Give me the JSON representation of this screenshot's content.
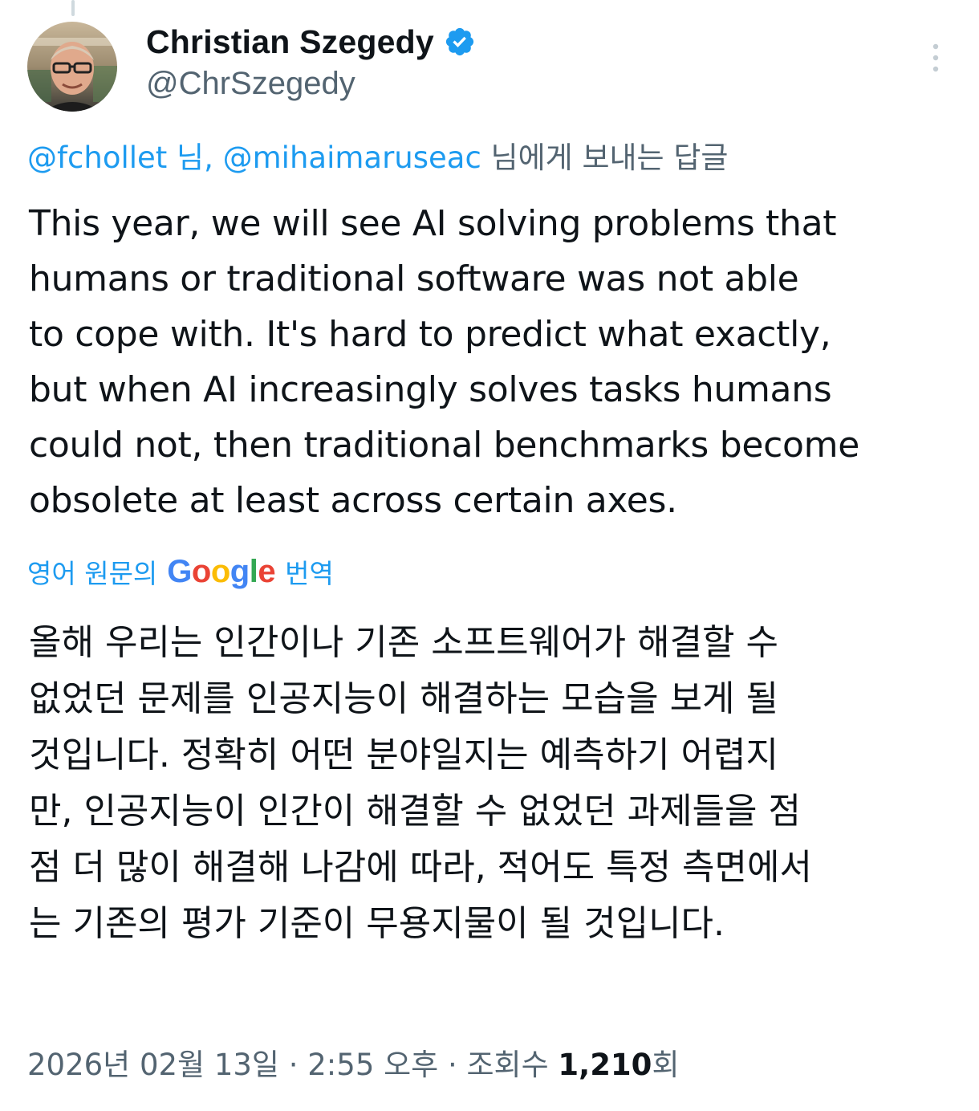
{
  "author": {
    "display_name": "Christian Szegedy",
    "handle": "@ChrSzegedy",
    "verified_icon": "verified-badge-icon",
    "verified_color": "#1d9bf0"
  },
  "reply_to": {
    "mention_1": "@fchollet",
    "separator_1": " 님, ",
    "mention_2": "@mihaimaruseac",
    "suffix": " 님에게 보내는 답글"
  },
  "tweet": {
    "lines": [
      "This year, we will see AI solving problems that",
      "humans or traditional software was not able",
      "to cope with. It's hard to predict what exactly,",
      "but when AI increasingly solves tasks humans",
      "could not, then traditional benchmarks become",
      "obsolete at least across certain axes."
    ]
  },
  "translation": {
    "prefix": "영어 원문의",
    "google_letters": [
      "G",
      "o",
      "o",
      "g",
      "l",
      "e"
    ],
    "suffix": "번역",
    "lines": [
      "올해 우리는 인간이나 기존 소프트웨어가 해결할 수",
      "없었던 문제를 인공지능이 해결하는 모습을 보게 될",
      "것입니다. 정확히 어떤 분야일지는 예측하기 어렵지",
      "만, 인공지능이 인간이 해결할 수 없었던 과제들을 점",
      "점 더 많이 해결해 나감에 따라, 적어도 특정 측면에서",
      "는 기존의 평가 기준이 무용지물이 될 것입니다."
    ]
  },
  "meta": {
    "date": "2026년 02월 13일",
    "dot_1": " · ",
    "time": "2:55 오후",
    "dot_2": " · ",
    "views_label": "조회수 ",
    "views_count": "1,210",
    "views_unit": "회"
  },
  "colors": {
    "accent": "#1d9bf0",
    "secondary_text": "#536471",
    "primary_text": "#0f1419"
  },
  "icons": {
    "more": "more-options-icon"
  }
}
